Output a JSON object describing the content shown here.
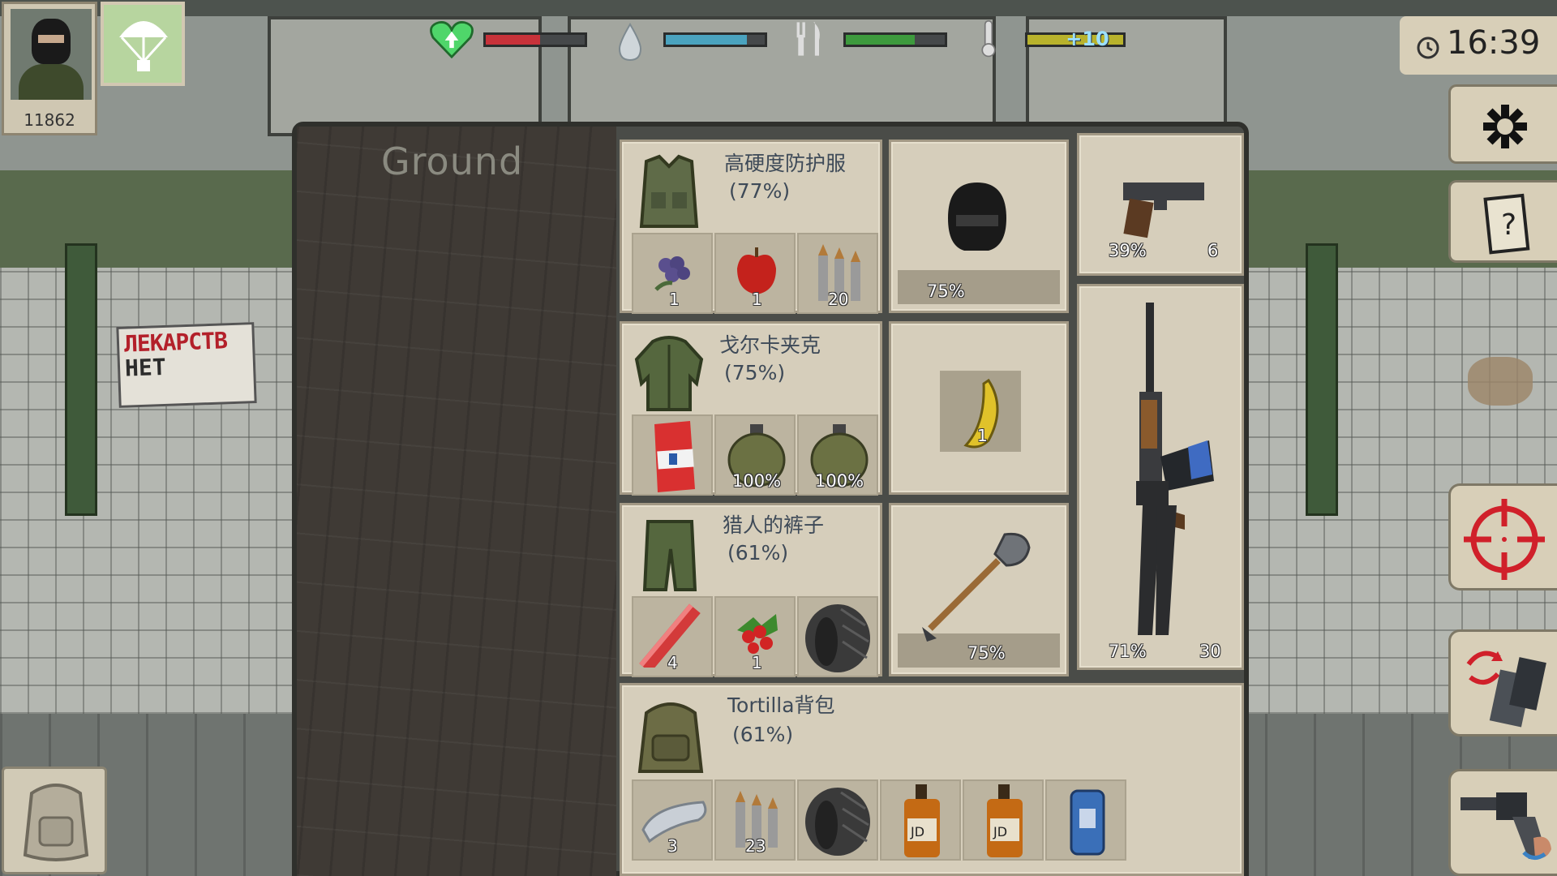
{
  "player": {
    "score": "11862"
  },
  "hud": {
    "health_fraction": 0.55,
    "water_fraction": 0.82,
    "food_fraction": 0.7,
    "temperature_label": "+10",
    "time": "16:39"
  },
  "colors": {
    "health": "#c8323a",
    "water": "#4aa3bf",
    "food": "#3d9a3d",
    "temperature": "#b8b22c",
    "card_title": "#3e4a58"
  },
  "ground": {
    "title": "Ground"
  },
  "sign": {
    "line1": "ЛЕКАРСТВ",
    "line2": "НЕТ"
  },
  "equipment": {
    "vest": {
      "title": "高硬度防护服",
      "condition": "(77%)",
      "slots": [
        {
          "icon": "blueberries-icon",
          "count": "1"
        },
        {
          "icon": "apple-icon",
          "count": "1"
        },
        {
          "icon": "bullets-icon",
          "count": "20"
        }
      ]
    },
    "helmet": {
      "icon": "helmet-icon",
      "condition": "75%"
    },
    "pistol": {
      "icon": "pistol-icon",
      "condition": "39%",
      "ammo": "6"
    },
    "jacket": {
      "title": "戈尔卡夹克",
      "condition": "(75%)",
      "slots": [
        {
          "icon": "bandage-box-icon",
          "count": ""
        },
        {
          "icon": "canteen-icon",
          "count": "100%"
        },
        {
          "icon": "canteen-icon",
          "count": "100%"
        }
      ]
    },
    "banana": {
      "icon": "banana-icon",
      "count": "1"
    },
    "pants": {
      "title": "猎人的裤子",
      "condition": "(61%)",
      "slots": [
        {
          "icon": "flare-icon",
          "count": "4"
        },
        {
          "icon": "berries-icon",
          "count": "1"
        },
        {
          "icon": "tire-icon",
          "count": ""
        }
      ]
    },
    "shovel": {
      "icon": "shovel-icon",
      "condition": "75%"
    },
    "rifle": {
      "icon": "rifle-icon",
      "condition": "71%",
      "ammo": "30"
    },
    "backpack": {
      "title": "Tortilla背包",
      "condition": "(61%)",
      "slots": [
        {
          "icon": "cloth-icon",
          "count": "3"
        },
        {
          "icon": "bullets-icon",
          "count": "23"
        },
        {
          "icon": "tire-icon",
          "count": ""
        },
        {
          "icon": "whiskey-icon",
          "count": ""
        },
        {
          "icon": "whiskey-icon",
          "count": ""
        },
        {
          "icon": "soda-can-icon",
          "count": ""
        }
      ]
    }
  }
}
